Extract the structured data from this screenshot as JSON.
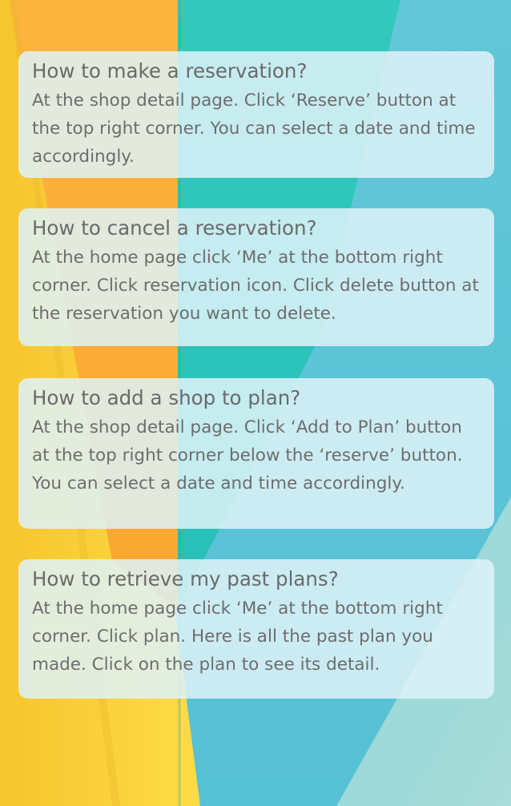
{
  "theme": {
    "yellow": "#fbd33a",
    "orange": "#fbb03b",
    "teal": "#2ec7be",
    "blue": "#5bc3d6",
    "card_background": "#def2f8",
    "text_color": "#6d6d6d"
  },
  "faq": [
    {
      "question": "How to make a reservation?",
      "answer": "At the shop detail page. Click ‘Reserve’ button at the top right corner. You can select a date and time accordingly."
    },
    {
      "question": "How to cancel a reservation?",
      "answer": "At the home page click ‘Me’ at the bottom right corner. Click reservation icon. Click delete button at the reservation you want to delete."
    },
    {
      "question": "How to add a shop to plan?",
      "answer": "At the shop detail page. Click ‘Add to Plan’ button at the top right corner below the ‘reserve’ button. You can select a date and time accordingly."
    },
    {
      "question": "How to retrieve my past plans?",
      "answer": "At the home page click ‘Me’ at the bottom right corner. Click plan. Here is all the past plan you made. Click on the plan to see its detail."
    }
  ]
}
